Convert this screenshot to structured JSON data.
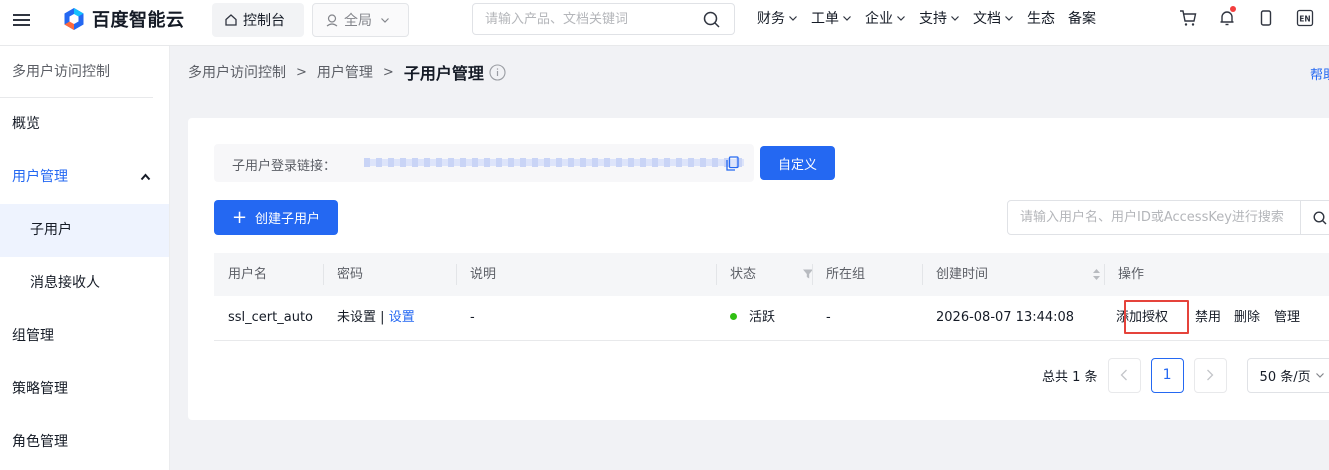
{
  "topbar": {
    "brand": "百度智能云",
    "console_label": "控制台",
    "region_label": "全局",
    "search_placeholder": "请输入产品、文档关键词",
    "nav": [
      "财务",
      "工单",
      "企业",
      "支持",
      "文档",
      "生态",
      "备案"
    ],
    "nav_has_caret": [
      true,
      true,
      true,
      true,
      true,
      false,
      false
    ],
    "icons": [
      "cart-icon",
      "bell-icon",
      "mobile-icon",
      "language-en-icon"
    ],
    "lang_label": "EN",
    "notification_dot_color": "#f33e3e"
  },
  "sidebar": {
    "title": "多用户访问控制",
    "items": [
      {
        "label": "概览"
      },
      {
        "label": "用户管理",
        "expanded": true
      },
      {
        "label": "子用户",
        "selected": true
      },
      {
        "label": "消息接收人"
      },
      {
        "label": "组管理"
      },
      {
        "label": "策略管理"
      },
      {
        "label": "角色管理"
      }
    ]
  },
  "breadcrumb": {
    "items": [
      "多用户访问控制",
      "用户管理"
    ],
    "current": "子用户管理"
  },
  "help_link": "帮助",
  "login_link": {
    "label": "子用户登录链接：",
    "custom_button": "自定义"
  },
  "create_button": "创建子用户",
  "user_search": {
    "placeholder": "请输入用户名、用户ID或AccessKey进行搜索"
  },
  "table": {
    "columns": [
      "用户名",
      "密码",
      "说明",
      "状态",
      "所在组",
      "创建时间",
      "操作"
    ],
    "rows": [
      {
        "username": "ssl_cert_auto",
        "password_status": "未设置",
        "password_sep": "|",
        "password_action": "设置",
        "description": "-",
        "status": "活跃",
        "group": "-",
        "created": "2026-08-07 13:44:08",
        "actions": [
          "添加授权",
          "禁用",
          "删除",
          "管理"
        ]
      }
    ]
  },
  "pagination": {
    "total_text": "总共 1 条",
    "current_page": "1",
    "page_size": "50 条/页"
  },
  "colors": {
    "accent": "#2468f2",
    "status_active": "#30bf13",
    "highlight_box": "#e5433b"
  }
}
